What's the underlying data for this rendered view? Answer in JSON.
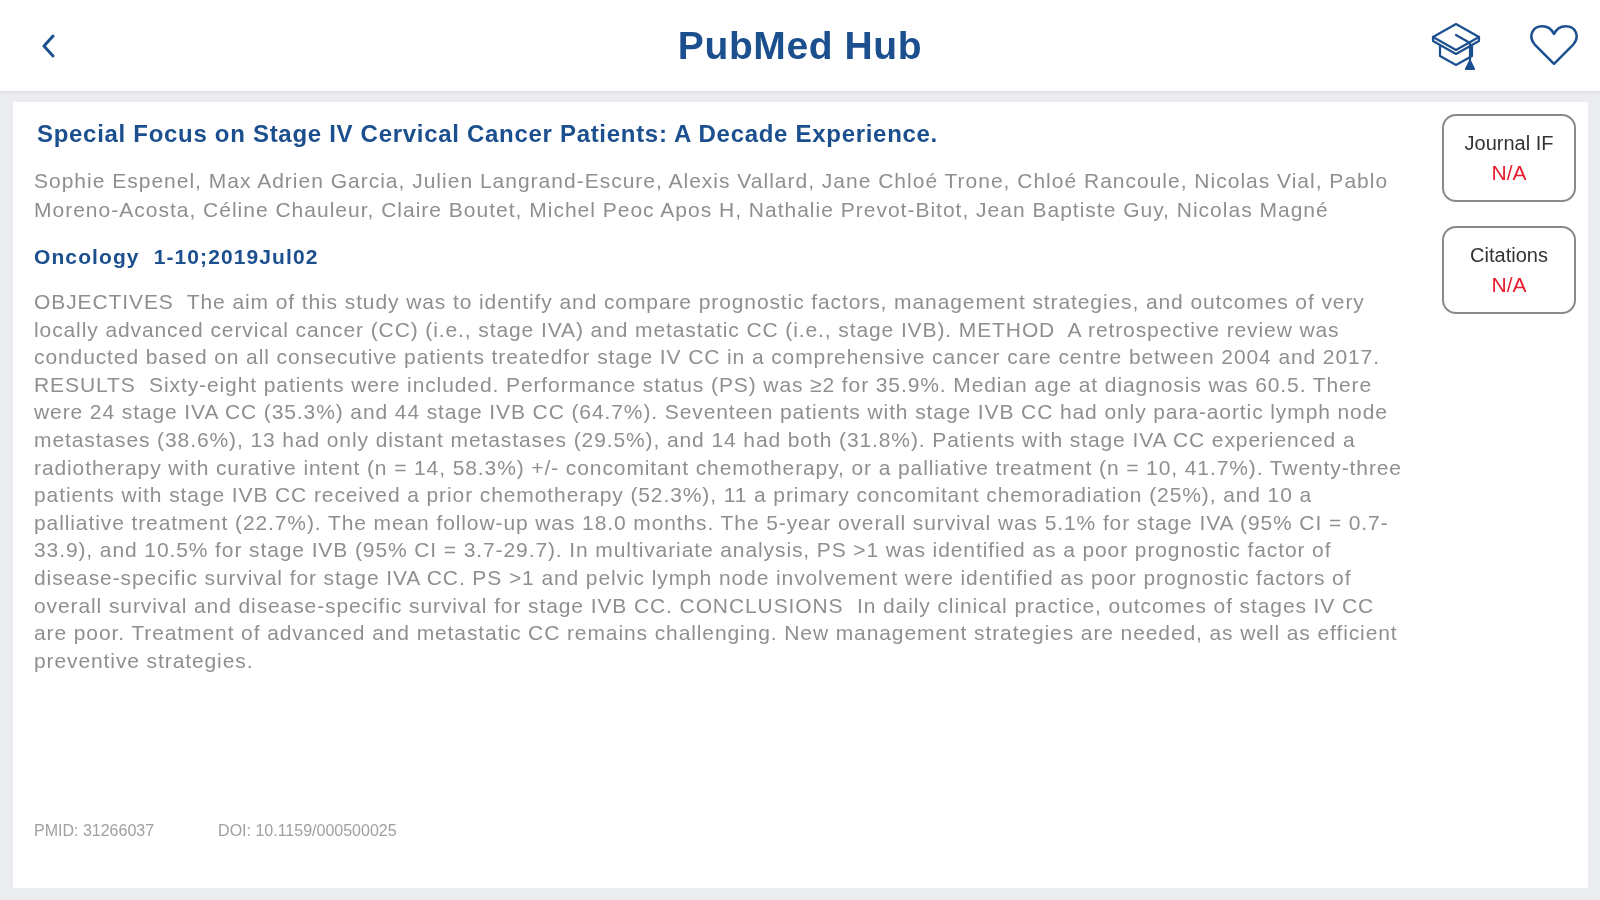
{
  "header": {
    "title": "PubMed Hub",
    "favorite": false
  },
  "article": {
    "title": "Special Focus on Stage IV Cervical Cancer Patients: A Decade Experience.",
    "authors": "Sophie Espenel, Max Adrien Garcia, Julien Langrand-Escure, Alexis Vallard, Jane Chloé Trone, Chloé Rancoule, Nicolas Vial, Pablo Moreno-Acosta, Céline Chauleur, Claire Boutet, Michel Peoc Apos H, Nathalie Prevot-Bitot, Jean Baptiste Guy, Nicolas Magné",
    "journal": "Oncology",
    "citation": "1-10;2019Jul02",
    "abstract": "OBJECTIVES  The aim of this study was to identify and compare prognostic factors, management strategies, and outcomes of very locally advanced cervical cancer (CC) (i.e., stage IVA) and metastatic CC (i.e., stage IVB). METHOD  A retrospective review was conducted based on all consecutive patients treatedfor stage IV CC in a comprehensive cancer care centre between 2004 and 2017. RESULTS  Sixty-eight patients were included. Performance status (PS) was ≥2 for 35.9%. Median age at diagnosis was 60.5. There were 24 stage IVA CC (35.3%) and 44 stage IVB CC (64.7%). Seventeen patients with stage IVB CC had only para-aortic lymph node metastases (38.6%), 13 had only distant metastases (29.5%), and 14 had both (31.8%). Patients with stage IVA CC experienced a radiotherapy with curative intent (n = 14, 58.3%) +/- concomitant chemotherapy, or a palliative treatment (n = 10, 41.7%). Twenty-three patients with stage IVB CC received a prior chemotherapy (52.3%), 11 a primary concomitant chemoradiation (25%), and 10 a palliative treatment (22.7%). The mean follow-up was 18.0 months. The 5-year overall survival was 5.1% for stage IVA (95% CI = 0.7-33.9), and 10.5% for stage IVB (95% CI = 3.7-29.7). In multivariate analysis, PS >1 was identified as a poor prognostic factor of disease-specific survival for stage IVA CC. PS >1 and pelvic lymph node involvement were identified as poor prognostic factors of overall survival and disease-specific survival for stage IVB CC. CONCLUSIONS  In daily clinical practice, outcomes of stages IV CC are poor. Treatment of advanced and metastatic CC remains challenging. New management strategies are needed, as well as efficient preventive strategies.",
    "pmid": "PMID: 31266037",
    "doi": "DOI: 10.1159/000500025"
  },
  "metrics": [
    {
      "label": "Journal IF",
      "value": "N/A"
    },
    {
      "label": "Citations",
      "value": "N/A"
    }
  ]
}
